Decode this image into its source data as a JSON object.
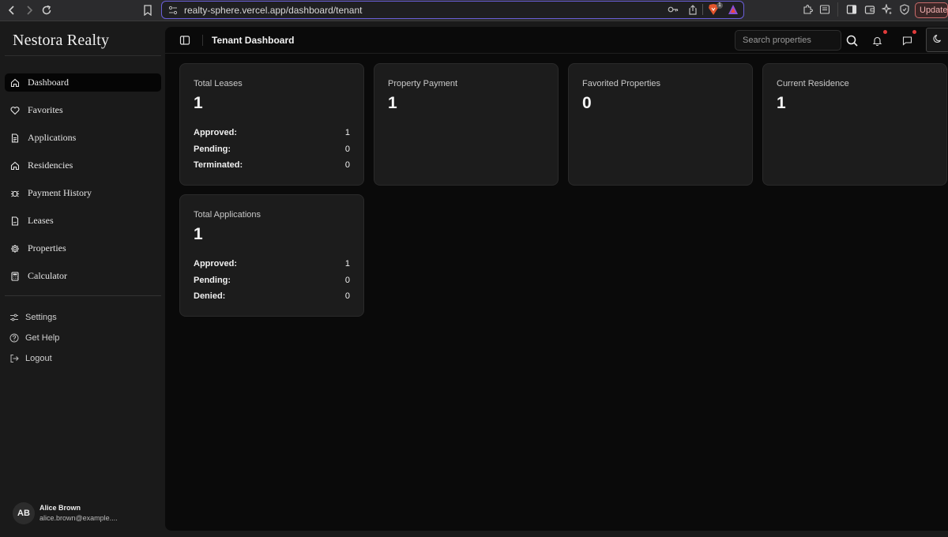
{
  "browser": {
    "url": "realty-sphere.vercel.app/dashboard/tenant",
    "update_label": "Update",
    "ext_badge": "1"
  },
  "sidebar": {
    "brand": "Nestora Realty",
    "items": [
      {
        "label": "Dashboard",
        "icon": "home-icon",
        "active": true
      },
      {
        "label": "Favorites",
        "icon": "heart-icon"
      },
      {
        "label": "Applications",
        "icon": "file-text-icon"
      },
      {
        "label": "Residencies",
        "icon": "home-icon"
      },
      {
        "label": "Payment History",
        "icon": "bug-icon"
      },
      {
        "label": "Leases",
        "icon": "file-signature-icon"
      },
      {
        "label": "Properties",
        "icon": "gear-icon"
      },
      {
        "label": "Calculator",
        "icon": "calculator-icon"
      }
    ],
    "secondary": [
      {
        "label": "Settings",
        "icon": "sliders-icon"
      },
      {
        "label": "Get Help",
        "icon": "help-circle-icon"
      },
      {
        "label": "Logout",
        "icon": "logout-icon"
      }
    ],
    "user": {
      "initials": "AB",
      "name": "Alice Brown",
      "email": "alice.brown@example...."
    }
  },
  "header": {
    "title": "Tenant Dashboard",
    "search_placeholder": "Search properties"
  },
  "cards": [
    {
      "title": "Total Leases",
      "value": "1",
      "rows": [
        {
          "label": "Approved:",
          "value": "1"
        },
        {
          "label": "Pending:",
          "value": "0"
        },
        {
          "label": "Terminated:",
          "value": "0"
        }
      ]
    },
    {
      "title": "Property Payment",
      "value": "1"
    },
    {
      "title": "Favorited Properties",
      "value": "0"
    },
    {
      "title": "Current Residence",
      "value": "1"
    },
    {
      "title": "Total Applications",
      "value": "1",
      "rows": [
        {
          "label": "Approved:",
          "value": "1"
        },
        {
          "label": "Pending:",
          "value": "0"
        },
        {
          "label": "Denied:",
          "value": "0"
        }
      ]
    }
  ],
  "colors": {
    "accent_border": "#6a5fd8",
    "notification_dot": "#e23b3b"
  }
}
